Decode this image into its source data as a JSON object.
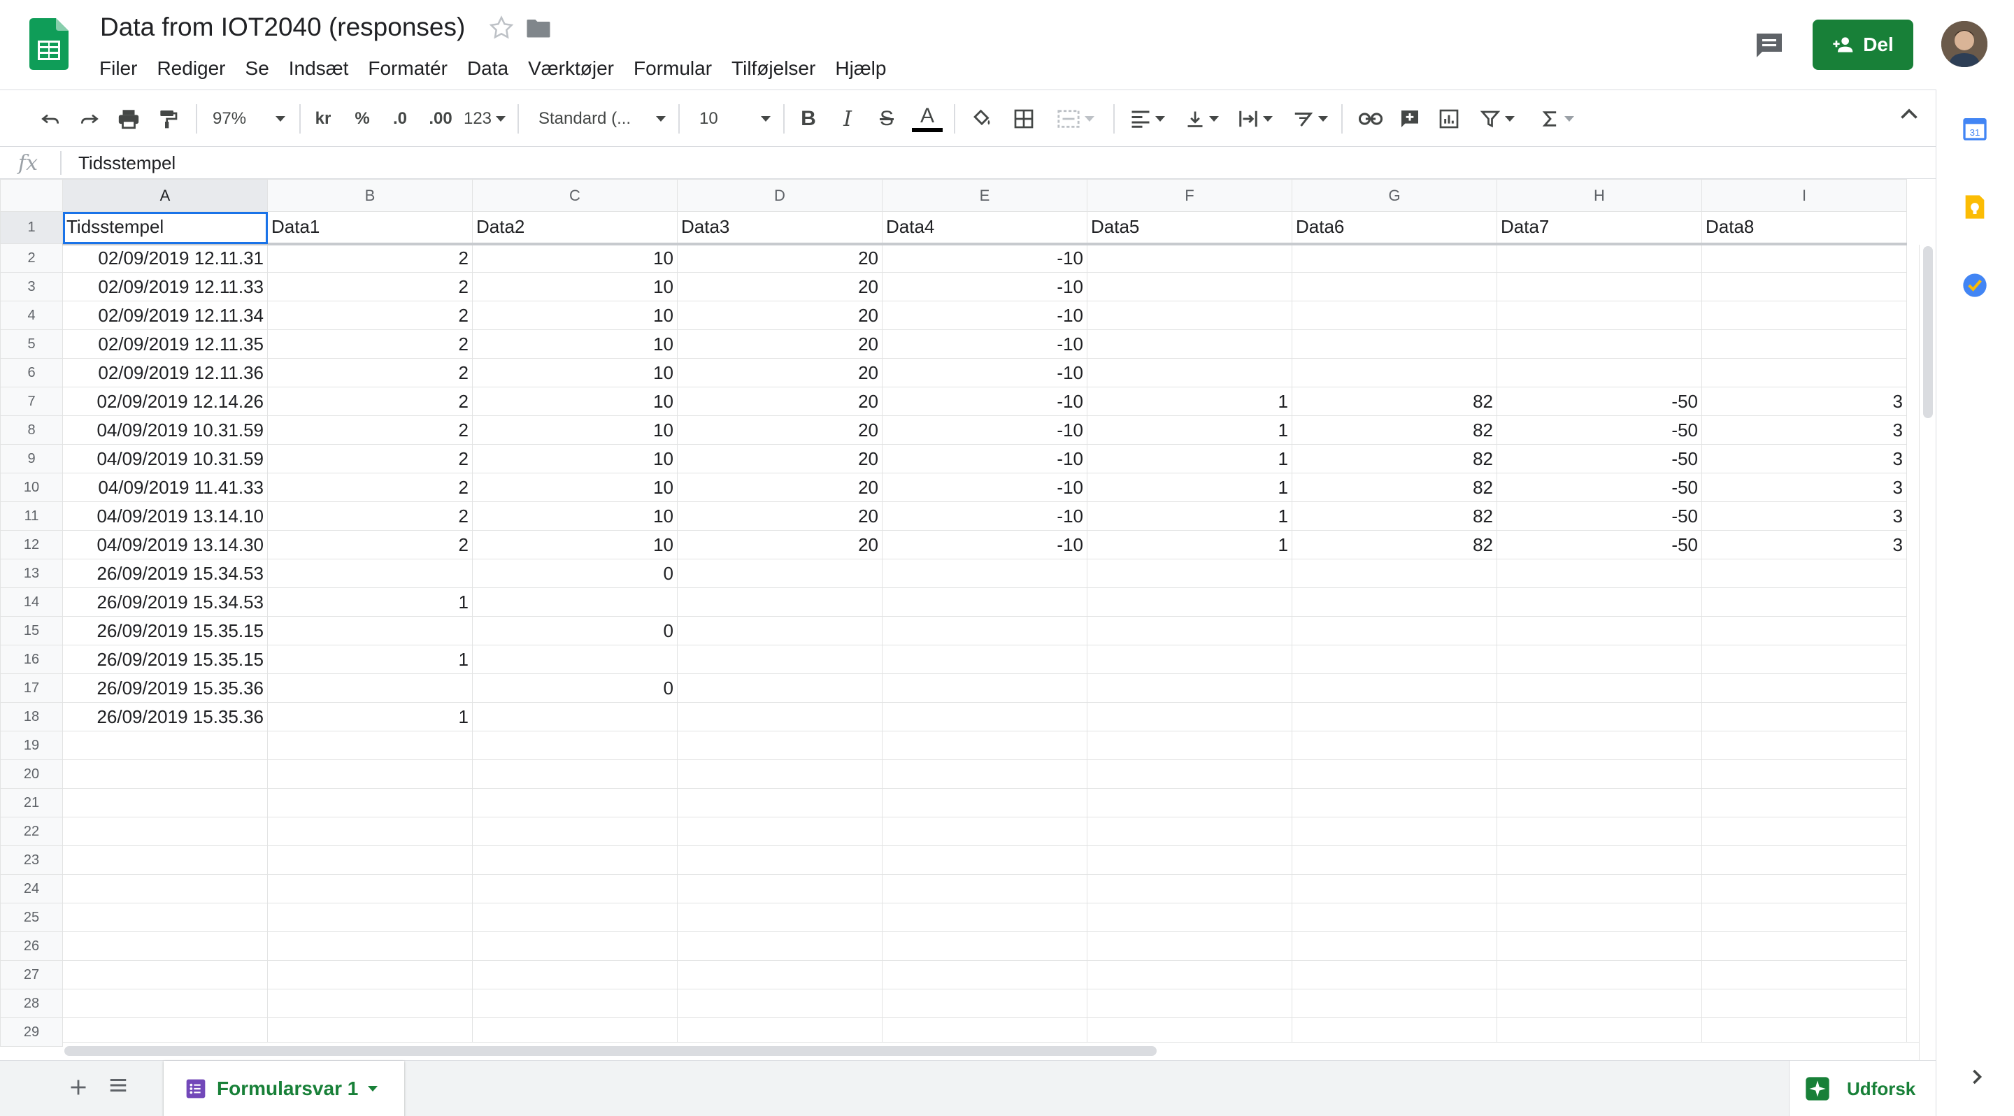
{
  "app": {
    "title": "Data from IOT2040 (responses)",
    "menu": [
      "Filer",
      "Rediger",
      "Se",
      "Indsæt",
      "Formatér",
      "Data",
      "Værktøjer",
      "Formular",
      "Tilføjelser",
      "Hjælp"
    ],
    "share_label": "Del"
  },
  "toolbar": {
    "zoom": "97%",
    "currency": "kr",
    "percent": "%",
    "decrease_decimals": ".0",
    "increase_decimals": ".00",
    "more_formats": "123",
    "font": "Standard (...",
    "font_size": "10",
    "bold": "B",
    "italic": "I",
    "strikethrough": "S",
    "text_color_letter": "A"
  },
  "formula_bar": {
    "fx": "fx",
    "value": "Tidsstempel"
  },
  "grid": {
    "columns": [
      "A",
      "B",
      "C",
      "D",
      "E",
      "F",
      "G",
      "H",
      "I"
    ],
    "header": [
      "Tidsstempel",
      "Data1",
      "Data2",
      "Data3",
      "Data4",
      "Data5",
      "Data6",
      "Data7",
      "Data8"
    ],
    "rows": [
      [
        "02/09/2019 12.11.31",
        "2",
        "10",
        "20",
        "-10",
        "",
        "",
        "",
        ""
      ],
      [
        "02/09/2019 12.11.33",
        "2",
        "10",
        "20",
        "-10",
        "",
        "",
        "",
        ""
      ],
      [
        "02/09/2019 12.11.34",
        "2",
        "10",
        "20",
        "-10",
        "",
        "",
        "",
        ""
      ],
      [
        "02/09/2019 12.11.35",
        "2",
        "10",
        "20",
        "-10",
        "",
        "",
        "",
        ""
      ],
      [
        "02/09/2019 12.11.36",
        "2",
        "10",
        "20",
        "-10",
        "",
        "",
        "",
        ""
      ],
      [
        "02/09/2019 12.14.26",
        "2",
        "10",
        "20",
        "-10",
        "1",
        "82",
        "-50",
        "3"
      ],
      [
        "04/09/2019 10.31.59",
        "2",
        "10",
        "20",
        "-10",
        "1",
        "82",
        "-50",
        "3"
      ],
      [
        "04/09/2019 10.31.59",
        "2",
        "10",
        "20",
        "-10",
        "1",
        "82",
        "-50",
        "3"
      ],
      [
        "04/09/2019 11.41.33",
        "2",
        "10",
        "20",
        "-10",
        "1",
        "82",
        "-50",
        "3"
      ],
      [
        "04/09/2019 13.14.10",
        "2",
        "10",
        "20",
        "-10",
        "1",
        "82",
        "-50",
        "3"
      ],
      [
        "04/09/2019 13.14.30",
        "2",
        "10",
        "20",
        "-10",
        "1",
        "82",
        "-50",
        "3"
      ],
      [
        "26/09/2019 15.34.53",
        "",
        "0",
        "",
        "",
        "",
        "",
        "",
        ""
      ],
      [
        "26/09/2019 15.34.53",
        "1",
        "",
        "",
        "",
        "",
        "",
        "",
        ""
      ],
      [
        "26/09/2019 15.35.15",
        "",
        "0",
        "",
        "",
        "",
        "",
        "",
        ""
      ],
      [
        "26/09/2019 15.35.15",
        "1",
        "",
        "",
        "",
        "",
        "",
        "",
        ""
      ],
      [
        "26/09/2019 15.35.36",
        "",
        "0",
        "",
        "",
        "",
        "",
        "",
        ""
      ],
      [
        "26/09/2019 15.35.36",
        "1",
        "",
        "",
        "",
        "",
        "",
        "",
        ""
      ]
    ],
    "row_numbers": [
      "1",
      "2",
      "3",
      "4",
      "5",
      "6",
      "7",
      "8",
      "9",
      "10",
      "11",
      "12",
      "13",
      "14",
      "15",
      "16",
      "17",
      "18",
      "19",
      "20",
      "21",
      "22",
      "23",
      "24",
      "25",
      "26",
      "27",
      "28",
      "29"
    ]
  },
  "sheets": {
    "active_tab": "Formularsvar 1",
    "explore_label": "Udforsk"
  },
  "side_panel": {
    "calendar_day": "31"
  },
  "colors": {
    "brand_green": "#188038",
    "selection_blue": "#1a73e8"
  }
}
